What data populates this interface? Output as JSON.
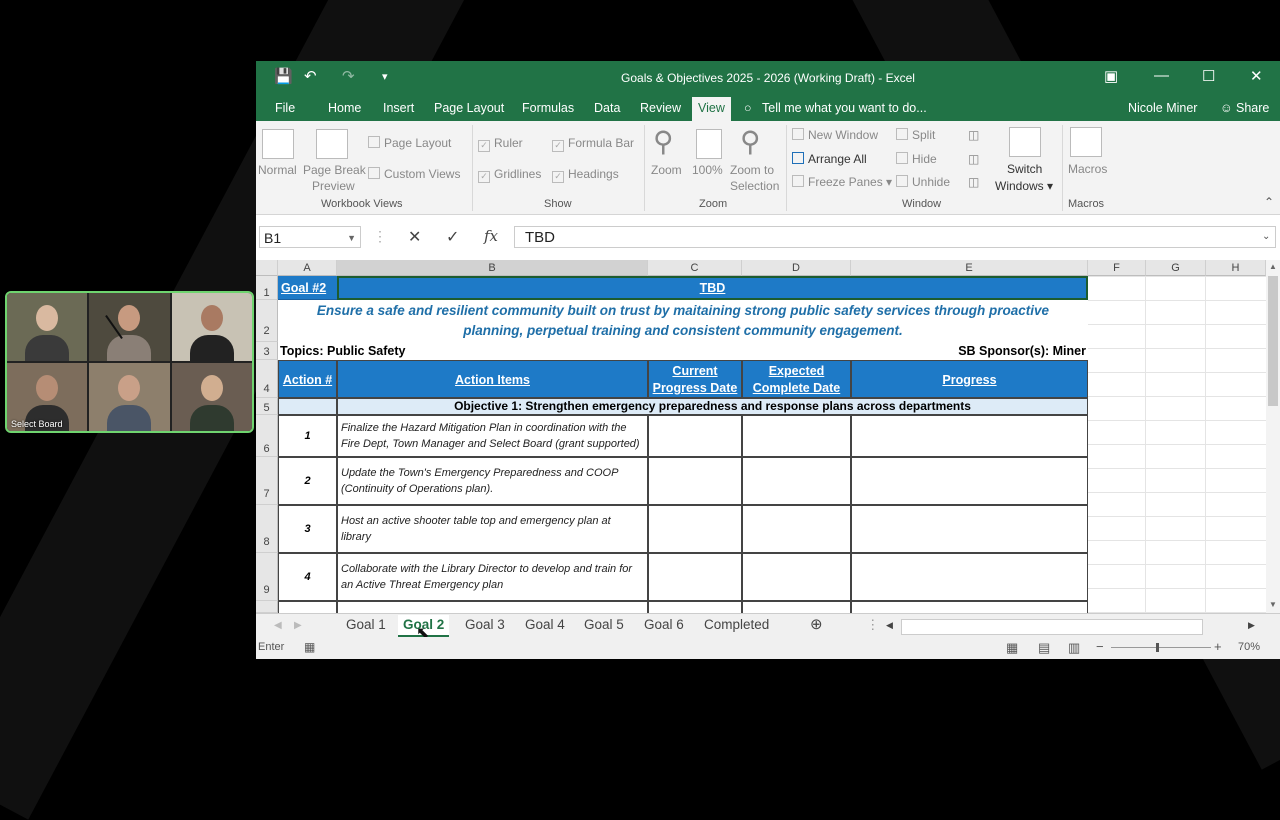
{
  "video": {
    "label": "Select Board"
  },
  "titlebar": {
    "title": "Goals & Objectives 2025 - 2026 (Working Draft) - Excel"
  },
  "menu": {
    "items": [
      "File",
      "Home",
      "Insert",
      "Page Layout",
      "Formulas",
      "Data",
      "Review",
      "View"
    ],
    "active": "View",
    "tell_me": "Tell me what you want to do...",
    "user": "Nicole Miner",
    "share": "Share"
  },
  "ribbon": {
    "workbook_views": {
      "normal": "Normal",
      "page_break": "Page Break",
      "page_break2": "Preview",
      "page_layout": "Page Layout",
      "custom_views": "Custom Views",
      "label": "Workbook Views"
    },
    "show": {
      "ruler": "Ruler",
      "formula_bar": "Formula Bar",
      "gridlines": "Gridlines",
      "headings": "Headings",
      "label": "Show"
    },
    "zoom": {
      "zoom": "Zoom",
      "hundred": "100%",
      "zoom_to": "Zoom to",
      "selection": "Selection",
      "label": "Zoom"
    },
    "window": {
      "new_window": "New Window",
      "arrange_all": "Arrange All",
      "freeze_panes": "Freeze Panes",
      "split": "Split",
      "hide": "Hide",
      "unhide": "Unhide",
      "switch": "Switch",
      "windows": "Windows",
      "label": "Window"
    },
    "macros": {
      "macros": "Macros",
      "label": "Macros"
    }
  },
  "formula_bar": {
    "name_box": "B1",
    "value": "TBD"
  },
  "columns": [
    "A",
    "B",
    "C",
    "D",
    "E",
    "F",
    "G",
    "H"
  ],
  "rows": [
    "1",
    "2",
    "3",
    "4",
    "5",
    "6",
    "7",
    "8",
    "9"
  ],
  "sheet": {
    "goal": "Goal #2",
    "tbd": "TBD",
    "statement_line1": "Ensure a safe and resilient community built on trust by maitaining strong public safety services through proactive",
    "statement_line2": "planning, perpetual training and consistent community engagement.",
    "topics": "Topics: Public Safety",
    "sponsor": "SB Sponsor(s):  Miner",
    "headers": {
      "action": "Action #",
      "items": "Action Items",
      "current1": "Current",
      "current2": "Progress Date",
      "expected1": "Expected",
      "expected2": "Complete Date",
      "progress": "Progress"
    },
    "objective": "Objective 1:  Strengthen emergency preparedness and response plans across departments",
    "actions": [
      {
        "num": "1",
        "line1": "Finalize the Hazard Mitigation Plan in coordination with the",
        "line2": "Fire Dept, Town Manager and Select Board (grant supported)"
      },
      {
        "num": "2",
        "line1": "Update the Town's Emergency Preparedness and COOP",
        "line2": "(Continuity of Operations plan)."
      },
      {
        "num": "3",
        "line1": "Host an active shooter table top and emergency plan at",
        "line2": "library"
      },
      {
        "num": "4",
        "line1": "Collaborate with the Library Director to develop and train for",
        "line2": "an Active Threat Emergency plan"
      }
    ]
  },
  "tabs": [
    "Goal 1",
    "Goal 2",
    "Goal 3",
    "Goal 4",
    "Goal 5",
    "Goal 6",
    "Completed"
  ],
  "active_tab": "Goal 2",
  "status": {
    "mode": "Enter",
    "zoom": "70%"
  }
}
